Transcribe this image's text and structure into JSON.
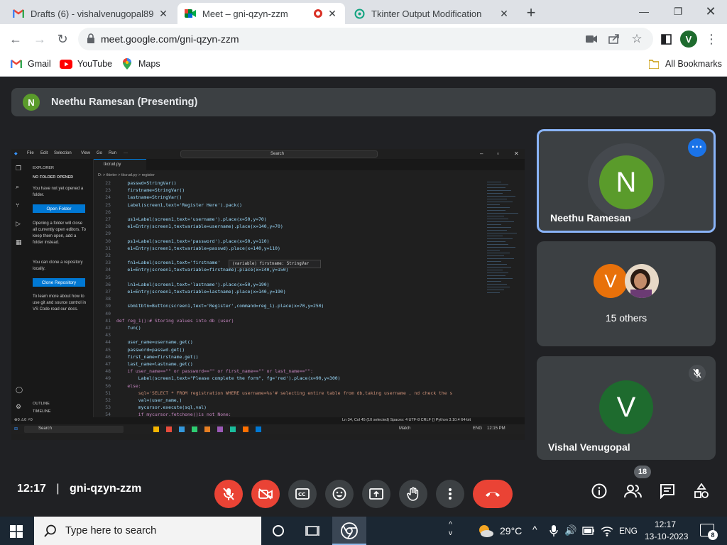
{
  "browser": {
    "tabs": [
      {
        "title": "Drafts (6) - vishalvenugopal89@",
        "icon": "gmail-icon"
      },
      {
        "title": "Meet – gni-qzyn-zzm",
        "icon": "meet-icon",
        "active": true
      },
      {
        "title": "Tkinter Output Modification",
        "icon": "chatgpt-icon"
      }
    ],
    "url": "meet.google.com/gni-qzyn-zzm",
    "profile_initial": "V",
    "bookmarks": [
      {
        "label": "Gmail",
        "icon": "gmail-icon"
      },
      {
        "label": "YouTube",
        "icon": "youtube-icon"
      },
      {
        "label": "Maps",
        "icon": "maps-icon"
      }
    ],
    "all_bookmarks": "All Bookmarks"
  },
  "meet": {
    "presenter_initial": "N",
    "presenter_label": "Neethu Ramesan (Presenting)",
    "participants": [
      {
        "name": "Neethu Ramesan",
        "initial": "N",
        "color": "#5a9b2b"
      },
      {
        "name": "15 others",
        "initial": "V",
        "color": "#e8710a"
      },
      {
        "name": "Vishal Venugopal",
        "initial": "V",
        "color": "#1e6b2e"
      }
    ],
    "time": "12:17",
    "separator": "|",
    "meeting_code": "gni-qzyn-zzm",
    "people_count": "18"
  },
  "shared_screen": {
    "menu": [
      "File",
      "Edit",
      "Selection",
      "View",
      "Go",
      "Run",
      "···"
    ],
    "search": "Search",
    "tab": "tkcrud.py",
    "breadcrumb": "D: > tkinter > tkcrud.py > register",
    "explorer": "EXPLORER",
    "no_folder": "NO FOLDER OPENED",
    "side_text_1": "You have not yet opened a folder.",
    "open_folder": "Open Folder",
    "side_text_2": "Opening a folder will close all currently open editors. To keep them open, add a folder instead.",
    "side_text_3": "You can clone a repository locally.",
    "clone_repo": "Clone Repository",
    "side_text_4": "To learn more about how to use git and source control in VS Code read our docs.",
    "outline": "OUTLINE",
    "timeline": "TIMELINE",
    "tooltip": "(variable) firstname: StringVar",
    "status_left": "⊗0 ⚠0   ⚡0",
    "status_right": "Ln 34, Col 45 (10 selected)   Spaces: 4   UTF-8   CRLF   {} Python   3.10.4 64-bit",
    "taskbar_search": "Search",
    "taskbar_match": "Match",
    "taskbar_lang": "ENG",
    "taskbar_time": "12:15 PM",
    "code": [
      {
        "n": "22",
        "t": "    passwd=StringVar()"
      },
      {
        "n": "23",
        "t": "    firstname=StringVar()"
      },
      {
        "n": "24",
        "t": "    lastname=StringVar()"
      },
      {
        "n": "25",
        "t": "    Label(screen1,text='Register Here').pack()"
      },
      {
        "n": "26",
        "t": ""
      },
      {
        "n": "27",
        "t": "    us1=Label(screen1,text='username').place(x=50,y=70)"
      },
      {
        "n": "28",
        "t": "    e1=Entry(screen1,textvariable=username).place(x=140,y=70)"
      },
      {
        "n": "29",
        "t": ""
      },
      {
        "n": "30",
        "t": "    ps1=Label(screen1,text='password').place(x=50,y=110)"
      },
      {
        "n": "31",
        "t": "    e1=Entry(screen1,textvariable=passwd).place(x=140,y=110)"
      },
      {
        "n": "32",
        "t": ""
      },
      {
        "n": "33",
        "t": "    fn1=Label(screen1,text='firstname'"
      },
      {
        "n": "34",
        "t": "    e1=Entry(screen1,textvariable=firstname).place(x=140,y=150)"
      },
      {
        "n": "35",
        "t": ""
      },
      {
        "n": "36",
        "t": "    ln1=Label(screen1,text='lastname').place(x=50,y=190)"
      },
      {
        "n": "37",
        "t": "    e1=Entry(screen1,textvariable=lastname).place(x=140,y=190)"
      },
      {
        "n": "38",
        "t": ""
      },
      {
        "n": "39",
        "t": "    sbmitbtn=Button(screen1,text='Register',command=reg_1).place(x=70,y=250)"
      },
      {
        "n": "40",
        "t": ""
      },
      {
        "n": "41",
        "t": "def reg_1():# Storing values into db (user)"
      },
      {
        "n": "42",
        "t": "    fun()"
      },
      {
        "n": "43",
        "t": ""
      },
      {
        "n": "44",
        "t": "    user_name=username.get()"
      },
      {
        "n": "45",
        "t": "    password=passwd.get()"
      },
      {
        "n": "46",
        "t": "    first_name=firstname.get()"
      },
      {
        "n": "47",
        "t": "    last_name=lastname.get()"
      },
      {
        "n": "48",
        "t": "    if user_name==\"\" or password==\"\" or first_name==\"\" or last_name==\"\":"
      },
      {
        "n": "49",
        "t": "        Label(screen1,text=\"Please complete the form\", fg='red').place(x=90,y=300)"
      },
      {
        "n": "50",
        "t": "    else:"
      },
      {
        "n": "51",
        "t": "        sql='SELECT * FROM registration WHERE username=%s'# selecting entire table from db,taking username , nd check the s"
      },
      {
        "n": "52",
        "t": "        val=(user_name,)"
      },
      {
        "n": "53",
        "t": "        mycursor.execute(sql,val)"
      },
      {
        "n": "54",
        "t": "        if mycursor.fetchone()is not None:"
      }
    ]
  },
  "taskbar": {
    "search_placeholder": "Type here to search",
    "temperature": "29°C",
    "language": "ENG",
    "time": "12:17",
    "date": "13-10-2023",
    "notification_count": "8"
  }
}
